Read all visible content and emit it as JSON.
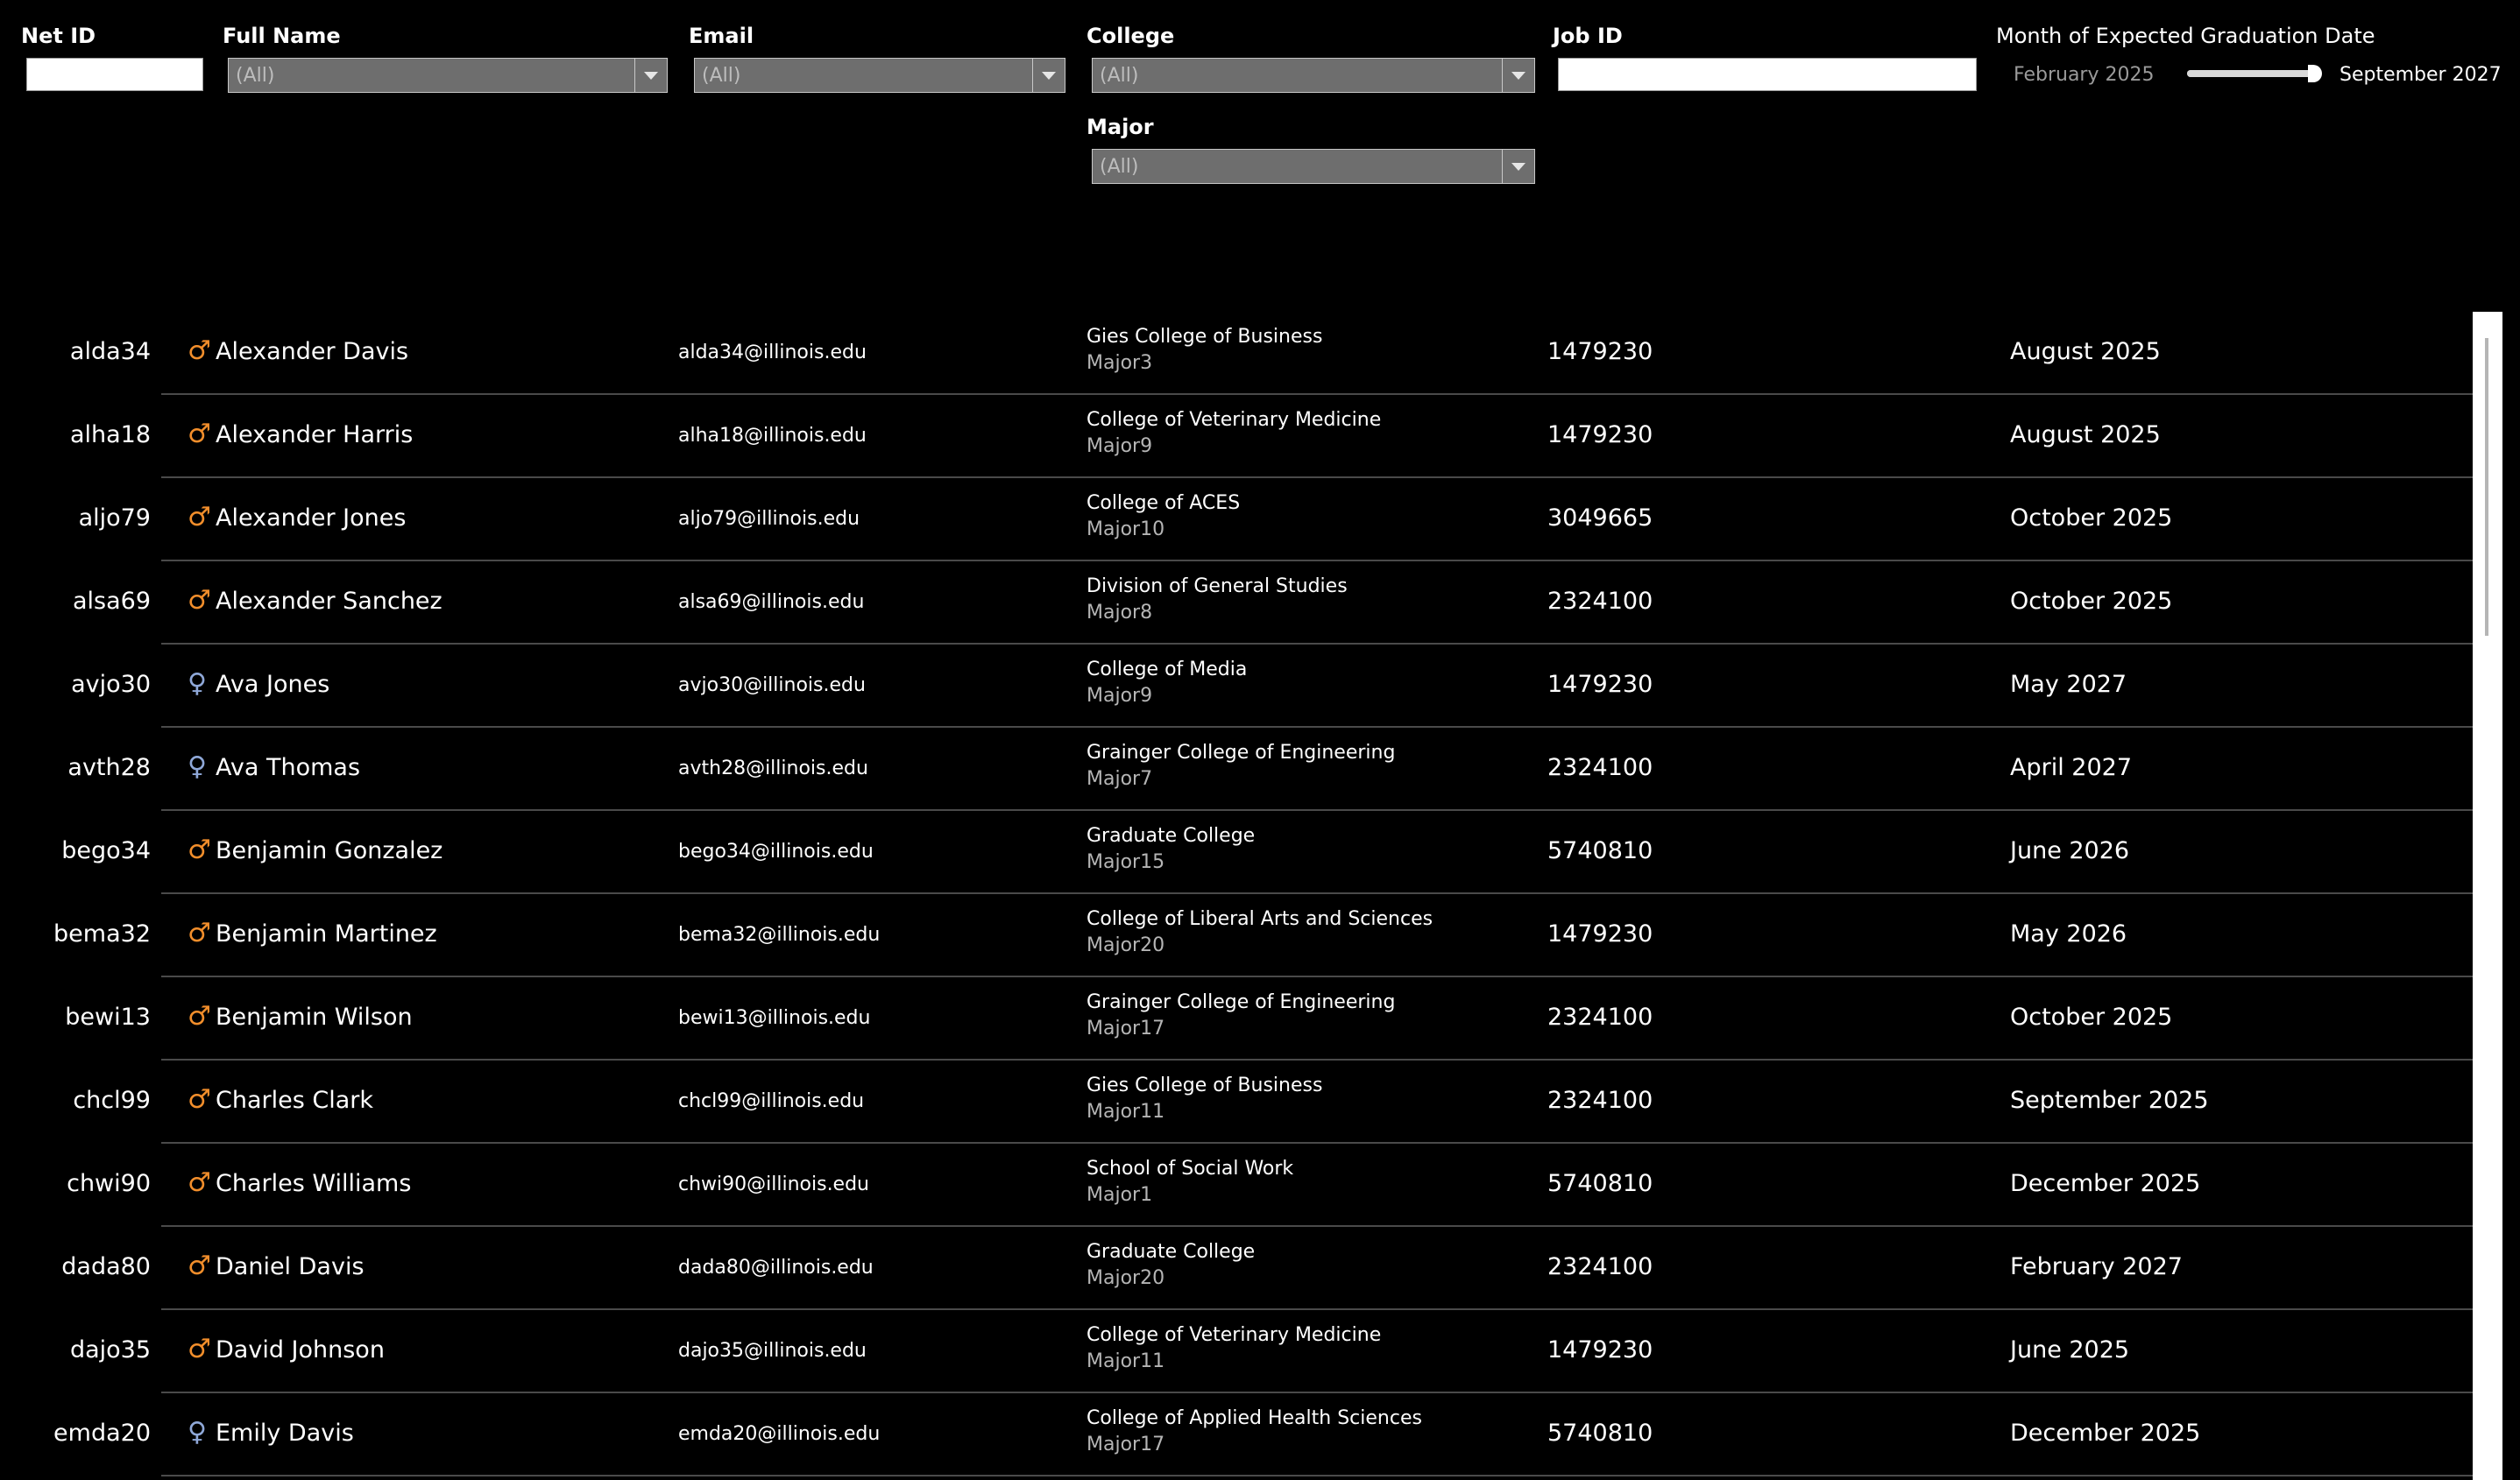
{
  "filters": {
    "net_id": {
      "label": "Net ID",
      "value": ""
    },
    "full_name": {
      "label": "Full Name",
      "value": "(All)"
    },
    "email": {
      "label": "Email",
      "value": "(All)"
    },
    "college": {
      "label": "College",
      "value": "(All)"
    },
    "major": {
      "label": "Major",
      "value": "(All)"
    },
    "job_id": {
      "label": "Job ID",
      "value": ""
    },
    "grad_date": {
      "label": "Month of Expected Graduation Date",
      "min": "February 2025",
      "max": "September 2027",
      "selected_fraction": 1.0
    }
  },
  "colors": {
    "male": "#f28e2b",
    "female": "#8fa8d8",
    "background": "#000000"
  },
  "rows": [
    {
      "net_id": "alda34",
      "gender": "male",
      "gender_icon": "♂",
      "name": "Alexander Davis",
      "email": "alda34@illinois.edu",
      "college": "Gies College of Business",
      "major": "Major3",
      "job_id": "1479230",
      "grad": "August 2025"
    },
    {
      "net_id": "alha18",
      "gender": "male",
      "gender_icon": "♂",
      "name": "Alexander Harris",
      "email": "alha18@illinois.edu",
      "college": "College of Veterinary Medicine",
      "major": "Major9",
      "job_id": "1479230",
      "grad": "August 2025"
    },
    {
      "net_id": "aljo79",
      "gender": "male",
      "gender_icon": "♂",
      "name": "Alexander Jones",
      "email": "aljo79@illinois.edu",
      "college": "College of ACES",
      "major": "Major10",
      "job_id": "3049665",
      "grad": "October 2025"
    },
    {
      "net_id": "alsa69",
      "gender": "male",
      "gender_icon": "♂",
      "name": "Alexander Sanchez",
      "email": "alsa69@illinois.edu",
      "college": "Division of General Studies",
      "major": "Major8",
      "job_id": "2324100",
      "grad": "October 2025"
    },
    {
      "net_id": "avjo30",
      "gender": "female",
      "gender_icon": "♀",
      "name": "Ava Jones",
      "email": "avjo30@illinois.edu",
      "college": "College of Media",
      "major": "Major9",
      "job_id": "1479230",
      "grad": "May 2027"
    },
    {
      "net_id": "avth28",
      "gender": "female",
      "gender_icon": "♀",
      "name": "Ava Thomas",
      "email": "avth28@illinois.edu",
      "college": "Grainger College of Engineering",
      "major": "Major7",
      "job_id": "2324100",
      "grad": "April 2027"
    },
    {
      "net_id": "bego34",
      "gender": "male",
      "gender_icon": "♂",
      "name": "Benjamin Gonzalez",
      "email": "bego34@illinois.edu",
      "college": "Graduate College",
      "major": "Major15",
      "job_id": "5740810",
      "grad": "June 2026"
    },
    {
      "net_id": "bema32",
      "gender": "male",
      "gender_icon": "♂",
      "name": "Benjamin Martinez",
      "email": "bema32@illinois.edu",
      "college": "College of Liberal Arts and Sciences",
      "major": "Major20",
      "job_id": "1479230",
      "grad": "May 2026"
    },
    {
      "net_id": "bewi13",
      "gender": "male",
      "gender_icon": "♂",
      "name": "Benjamin Wilson",
      "email": "bewi13@illinois.edu",
      "college": "Grainger College of Engineering",
      "major": "Major17",
      "job_id": "2324100",
      "grad": "October 2025"
    },
    {
      "net_id": "chcl99",
      "gender": "male",
      "gender_icon": "♂",
      "name": "Charles Clark",
      "email": "chcl99@illinois.edu",
      "college": "Gies College of Business",
      "major": "Major11",
      "job_id": "2324100",
      "grad": "September 2025"
    },
    {
      "net_id": "chwi90",
      "gender": "male",
      "gender_icon": "♂",
      "name": "Charles Williams",
      "email": "chwi90@illinois.edu",
      "college": "School of Social Work",
      "major": "Major1",
      "job_id": "5740810",
      "grad": "December 2025"
    },
    {
      "net_id": "dada80",
      "gender": "male",
      "gender_icon": "♂",
      "name": "Daniel Davis",
      "email": "dada80@illinois.edu",
      "college": "Graduate College",
      "major": "Major20",
      "job_id": "2324100",
      "grad": "February 2027"
    },
    {
      "net_id": "dajo35",
      "gender": "male",
      "gender_icon": "♂",
      "name": "David Johnson",
      "email": "dajo35@illinois.edu",
      "college": "College of Veterinary Medicine",
      "major": "Major11",
      "job_id": "1479230",
      "grad": "June 2025"
    },
    {
      "net_id": "emda20",
      "gender": "female",
      "gender_icon": "♀",
      "name": "Emily Davis",
      "email": "emda20@illinois.edu",
      "college": "College of Applied Health Sciences",
      "major": "Major17",
      "job_id": "5740810",
      "grad": "December 2025"
    }
  ]
}
